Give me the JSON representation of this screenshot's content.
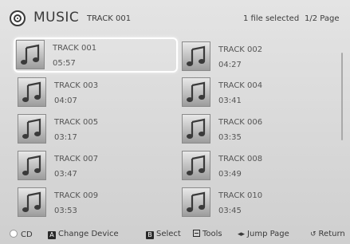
{
  "header": {
    "title": "MUSIC",
    "subtitle": "TRACK 001",
    "status": "1 file selected",
    "page": "1/2 Page"
  },
  "tracks": [
    {
      "name": "TRACK 001",
      "duration": "05:57",
      "selected": true
    },
    {
      "name": "TRACK 002",
      "duration": "04:27",
      "selected": false
    },
    {
      "name": "TRACK 003",
      "duration": "04:07",
      "selected": false
    },
    {
      "name": "TRACK 004",
      "duration": "03:41",
      "selected": false
    },
    {
      "name": "TRACK 005",
      "duration": "03:17",
      "selected": false
    },
    {
      "name": "TRACK 006",
      "duration": "03:35",
      "selected": false
    },
    {
      "name": "TRACK 007",
      "duration": "03:47",
      "selected": false
    },
    {
      "name": "TRACK 008",
      "duration": "03:49",
      "selected": false
    },
    {
      "name": "TRACK 009",
      "duration": "03:53",
      "selected": false
    },
    {
      "name": "TRACK 010",
      "duration": "03:45",
      "selected": false
    }
  ],
  "footer": {
    "cd": "CD",
    "change_device_key": "A",
    "change_device": "Change Device",
    "select_key": "B",
    "select": "Select",
    "tools": "Tools",
    "jump_page": "Jump Page",
    "return": "Return"
  },
  "icons": {
    "header": "disc-icon",
    "thumb": "music-note-icon",
    "cd": "dpad-icon",
    "tools": "tools-icon",
    "jump": "jump-arrows-icon",
    "return": "return-icon"
  }
}
